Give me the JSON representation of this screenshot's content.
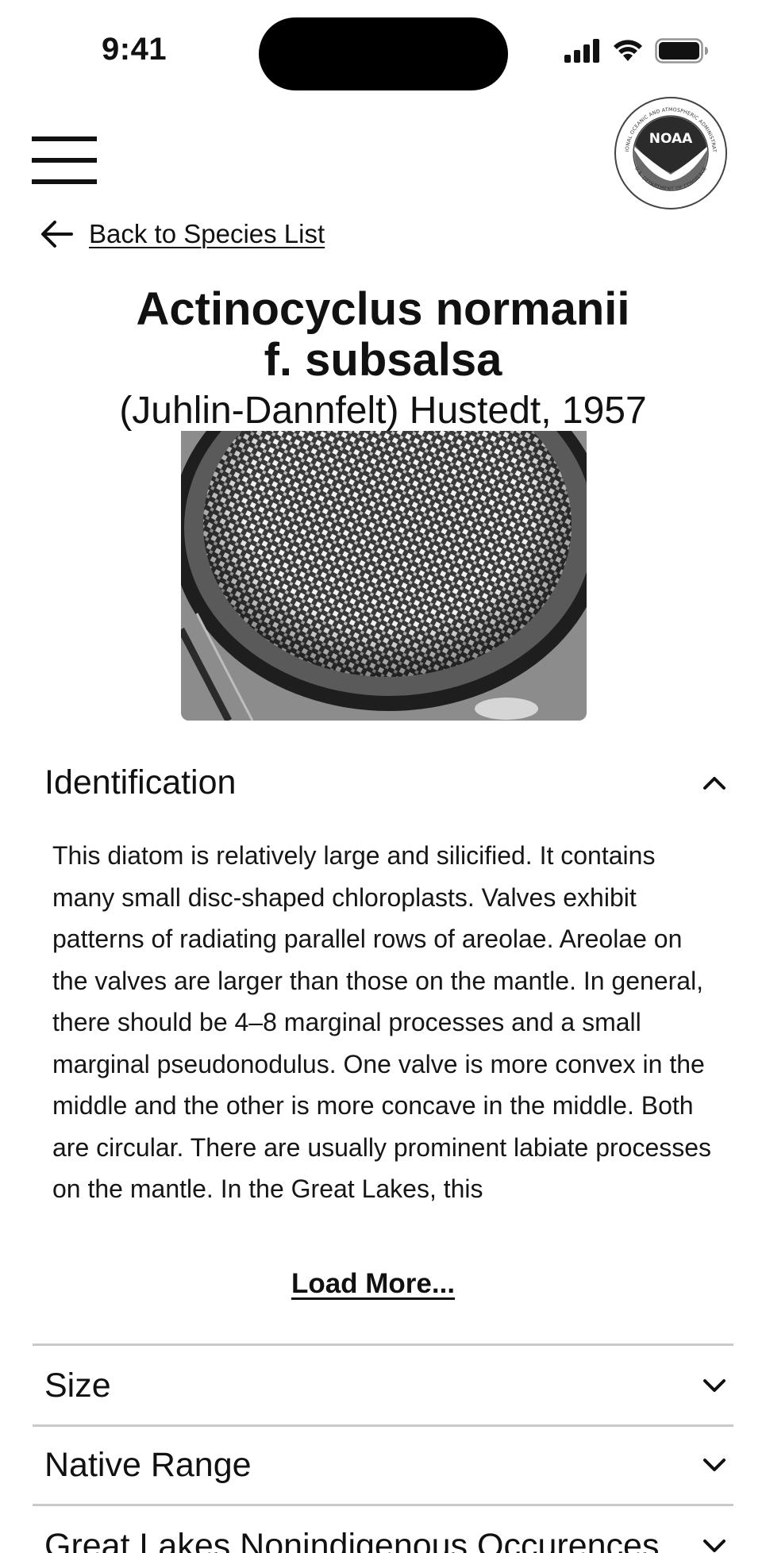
{
  "status_bar": {
    "time": "9:41"
  },
  "header": {
    "menu_icon": "hamburger-menu-icon",
    "logo": {
      "text": "NOAA",
      "ring_text": "NATIONAL OCEANIC AND ATMOSPHERIC ADMINISTRATION",
      "ring_text_bottom": "U.S. DEPARTMENT OF COMMERCE"
    }
  },
  "back_link": {
    "label": "Back to Species List",
    "icon": "arrow-left-icon"
  },
  "species": {
    "name_line1": "Actinocyclus normanii",
    "name_line2": "f. subsalsa",
    "authority": "(Juhlin-Dannfelt) Hustedt, 1957"
  },
  "sections": {
    "identification": {
      "title": "Identification",
      "expanded": true,
      "body": "This diatom is relatively large and silicified. It contains many small disc-shaped chloroplasts. Valves exhibit patterns of radiating parallel rows of areolae. Areolae on the valves are larger than those on the mantle. In general, there should be 4–8 marginal processes and a small marginal pseudonodulus. One valve is more convex in the middle and the other is more concave in the middle. Both are circular. There are usually prominent labiate processes on the mantle. In the Great Lakes, this",
      "load_more": "Load More..."
    },
    "size": {
      "title": "Size",
      "expanded": false
    },
    "native_range": {
      "title": "Native Range",
      "expanded": false
    },
    "occurrences": {
      "title": "Great Lakes Nonindigenous Occurences",
      "expanded": false
    }
  },
  "colors": {
    "text": "#111111",
    "divider": "#c9c9c9",
    "background": "#ffffff"
  }
}
